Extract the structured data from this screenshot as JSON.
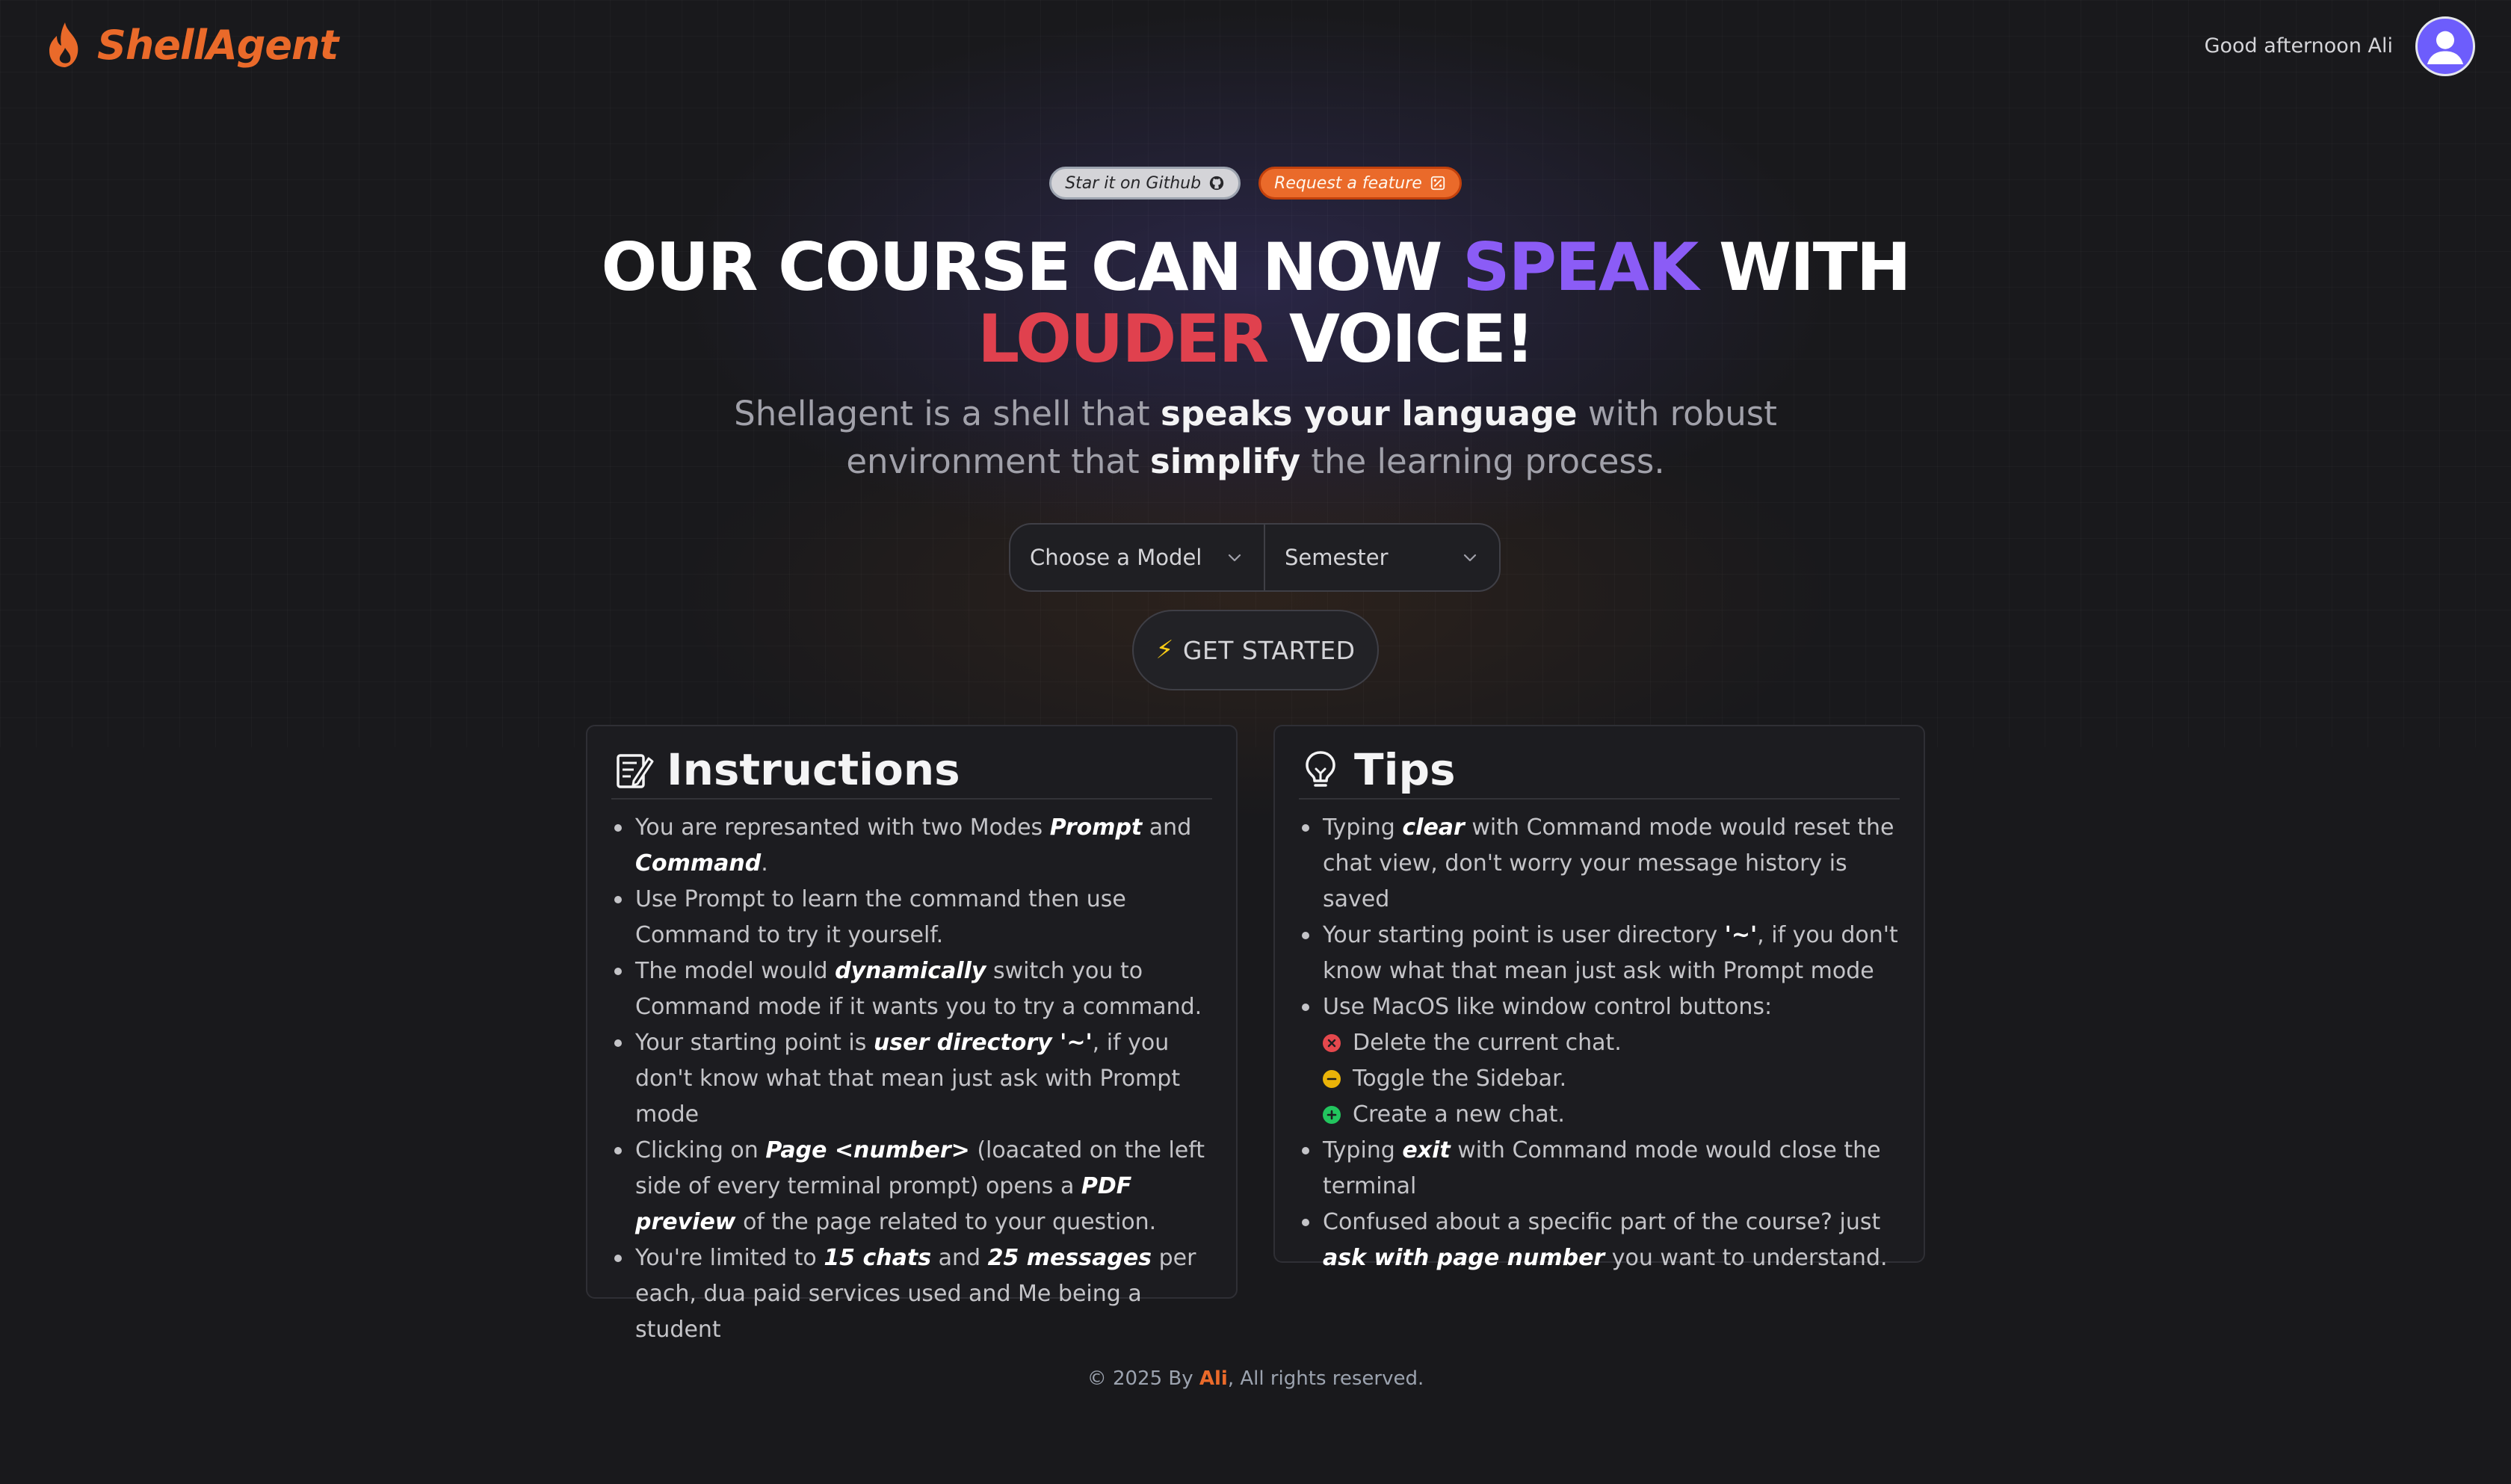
{
  "header": {
    "logo_text": "ShellAgent",
    "greeting": "Good afternoon Ali"
  },
  "pills": {
    "github": "Star it on Github",
    "feature": "Request a feature"
  },
  "hero": {
    "line1_a": "OUR COURSE CAN NOW ",
    "line1_accent": "SPEAK",
    "line1_b": " WITH",
    "line2_accent": "LOUDER",
    "line2_b": " VOICE!",
    "sub_1": "Shellagent is a shell that ",
    "sub_bold_1": "speaks your language",
    "sub_2": " with robust",
    "sub_3": "environment that ",
    "sub_bold_2": "simplify",
    "sub_4": " the learning process."
  },
  "selects": {
    "model": "Choose a Model",
    "semester": "Semester"
  },
  "cta": {
    "label": "GET STARTED"
  },
  "instructions": {
    "title": "Instructions",
    "items": [
      [
        "You are represanted with two Modes ",
        {
          "b": "Prompt"
        },
        " and ",
        {
          "b": "Command"
        },
        "."
      ],
      [
        "Use Prompt to learn the command then use Command to try it yourself."
      ],
      [
        "The model would ",
        {
          "b": "dynamically"
        },
        " switch you to Command mode if it wants you to try a command."
      ],
      [
        "Your starting point is ",
        {
          "b": "user directory '~'"
        },
        ", if you don't know what that mean just ask with Prompt mode"
      ],
      [
        "Clicking on ",
        {
          "b": "Page <number>"
        },
        " (loacated on the left side of every terminal prompt) opens a ",
        {
          "b": "PDF preview"
        },
        " of the page related to your question."
      ],
      [
        "You're limited to ",
        {
          "b": "15 chats"
        },
        " and ",
        {
          "b": "25 messages"
        },
        " per each, dua paid services used and Me being a student"
      ]
    ]
  },
  "tips": {
    "title": "Tips",
    "items": [
      {
        "segs": [
          "Typing ",
          {
            "b": "clear"
          },
          " with Command mode would reset the chat view, don't worry your message history is saved"
        ]
      },
      {
        "segs": [
          "Your starting point is user directory ",
          {
            "b": "'~'"
          },
          ", if you don't know what that mean just ask with Prompt mode"
        ]
      },
      {
        "segs": [
          "Use MacOS like window control buttons:"
        ]
      },
      {
        "sub": "red",
        "segs": [
          "Delete the current chat."
        ]
      },
      {
        "sub": "yellow",
        "segs": [
          "Toggle the Sidebar."
        ]
      },
      {
        "sub": "green",
        "segs": [
          "Create a new chat."
        ]
      },
      {
        "segs": [
          "Typing ",
          {
            "b": "exit"
          },
          " with Command mode would close the terminal"
        ]
      },
      {
        "segs": [
          "Confused about a specific part of the course? just ",
          {
            "b": "ask with page number"
          },
          " you want to understand."
        ]
      }
    ]
  },
  "footer": {
    "prefix": "© 2025 By ",
    "name": "Ali",
    "suffix": ", All rights reserved."
  },
  "colors": {
    "brand": "#ea6a2a",
    "accent_purple": "#8b5cf6",
    "accent_red": "#e0414e",
    "background": "#19191c"
  }
}
